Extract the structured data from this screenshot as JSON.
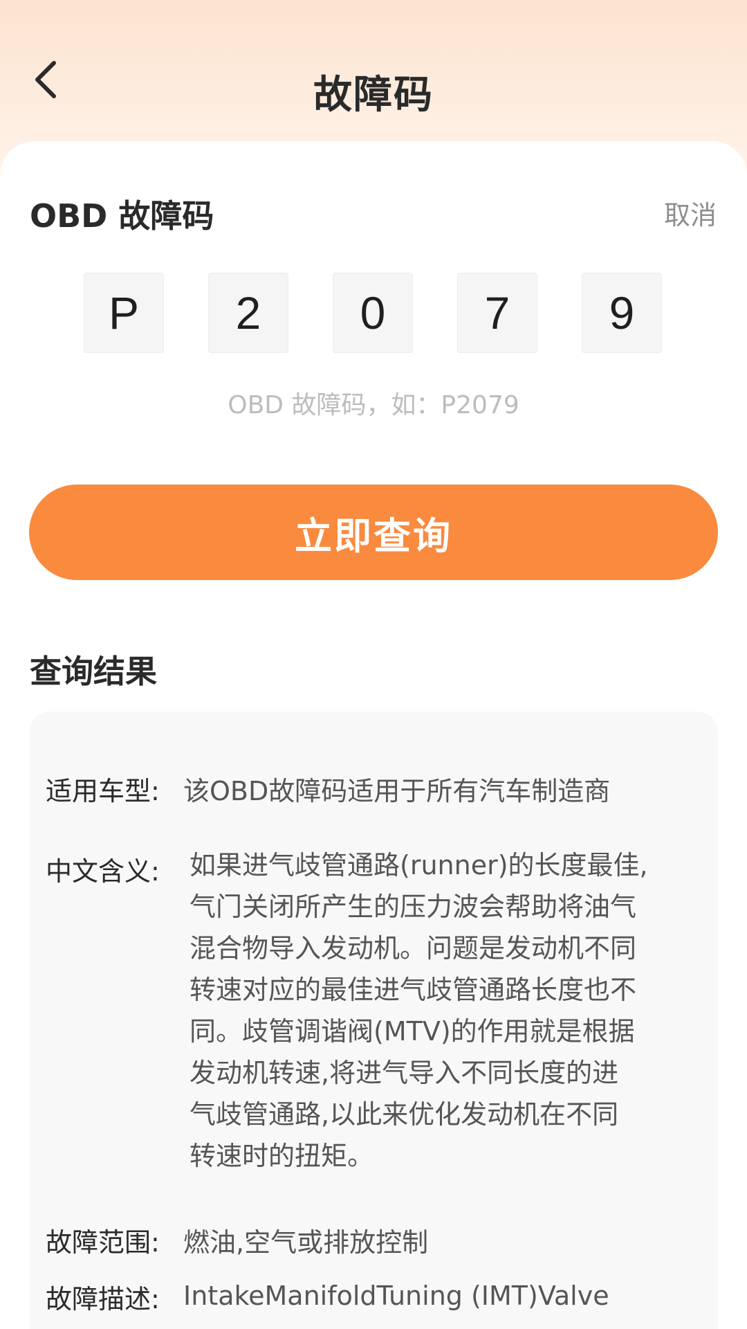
{
  "header": {
    "title": "故障码"
  },
  "form": {
    "section_title": "OBD 故障码",
    "cancel_label": "取消",
    "code_chars": [
      "P",
      "2",
      "0",
      "7",
      "9"
    ],
    "hint": "OBD 故障码，如：P2079",
    "query_button": "立即查询"
  },
  "result": {
    "title": "查询结果",
    "rows": {
      "vehicle_label": "适用车型:",
      "vehicle_value": "该OBD故障码适用于所有汽车制造商",
      "meaning_label": "中文含义:",
      "meaning_lines": [
        "如果进气歧管通路(runner)的长度最佳,",
        "气门关闭所产生的压力波会帮助将油气",
        "混合物导入发动机。问题是发动机不同",
        "转速对应的最佳进气歧管通路长度也不",
        "同。歧管调谐阀(MTV)的作用就是根据",
        "发动机转速,将进气导入不同长度的进",
        "气歧管通路,以此来优化发动机在不同",
        "转速时的扭矩。"
      ],
      "range_label": "故障范围:",
      "range_value": "燃油,空气或排放控制",
      "desc_label": "故障描述:",
      "desc_value": "IntakeManifoldTuning (IMT)Valve"
    }
  }
}
